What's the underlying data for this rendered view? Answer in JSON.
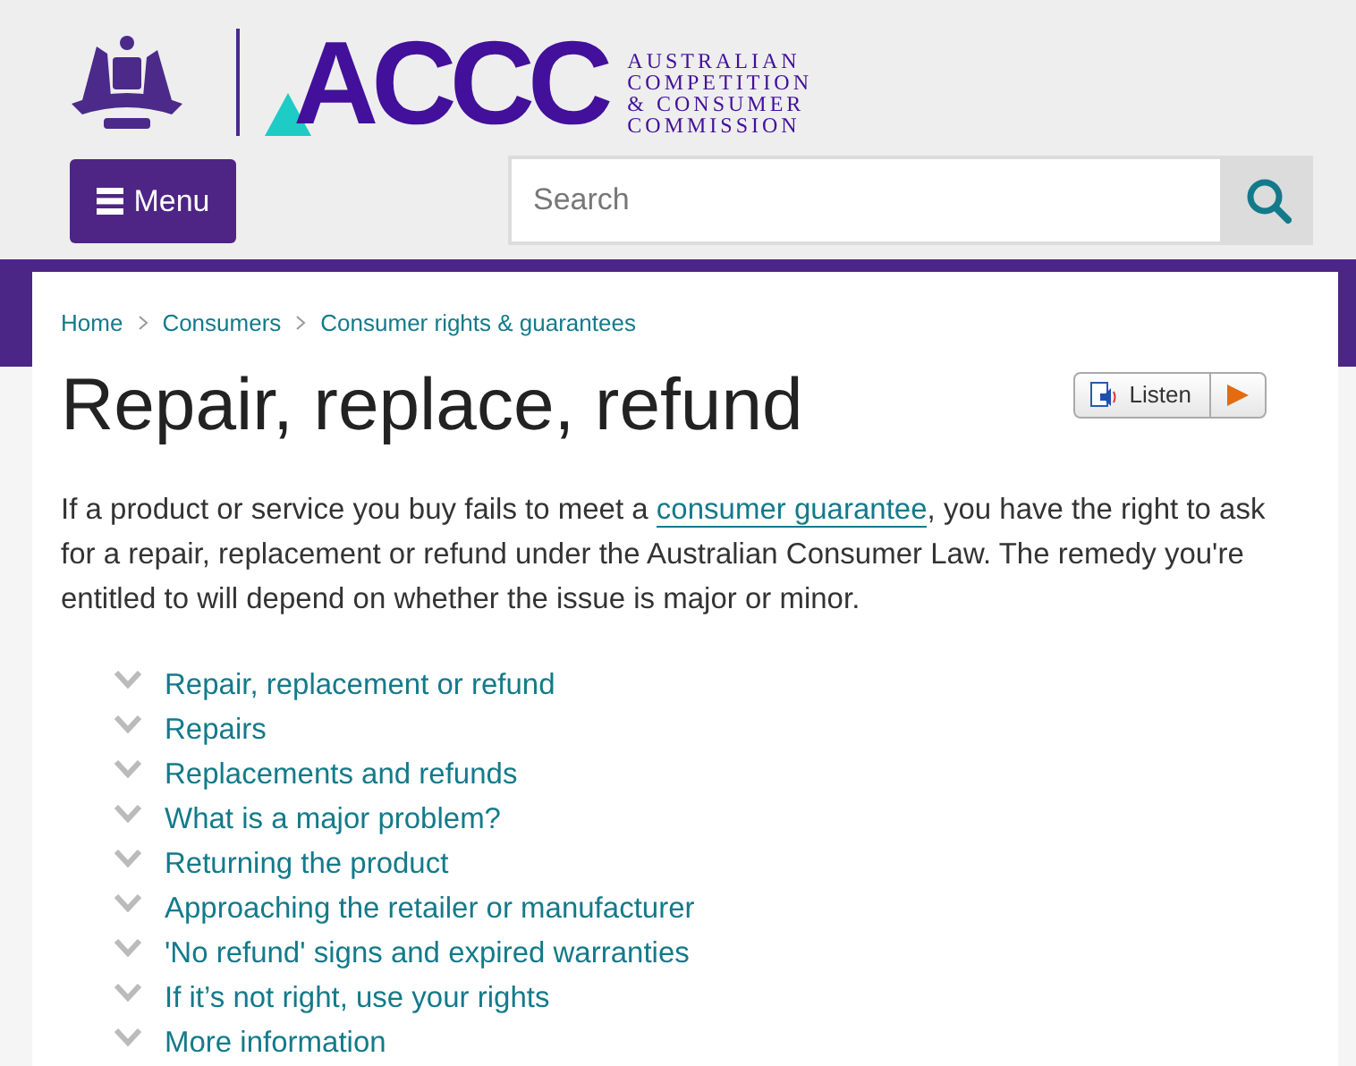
{
  "header": {
    "logo_text": "ACCC",
    "agency_name": [
      "AUSTRALIAN",
      "COMPETITION",
      "& CONSUMER",
      "COMMISSION"
    ],
    "menu_button": "Menu",
    "search": {
      "placeholder": "Search"
    }
  },
  "breadcrumbs": [
    "Home",
    "Consumers",
    "Consumer rights & guarantees"
  ],
  "title": "Repair, replace, refund",
  "listen_button": "Listen",
  "intro": {
    "before": "If a product or service you buy fails to meet a ",
    "link": "consumer guarantee",
    "after": ", you have the right to ask for a repair, replacement or refund under the Australian Consumer Law. The remedy you're entitled to will depend on whether the issue is major or minor."
  },
  "sections": [
    {
      "label": "Repair, replacement or refund",
      "expanded": false
    },
    {
      "label": "Repairs",
      "expanded": false
    },
    {
      "label": "Replacements and refunds",
      "expanded": false
    },
    {
      "label": "What is a major problem?",
      "expanded": false
    },
    {
      "label": "Returning the product",
      "expanded": false
    },
    {
      "label": "Approaching the retailer or manufacturer",
      "expanded": false
    },
    {
      "label": "'No refund' signs and expired warranties",
      "expanded": false
    },
    {
      "label": "If it’s not right, use your rights",
      "expanded": false
    },
    {
      "label": "More information",
      "expanded": false
    }
  ]
}
